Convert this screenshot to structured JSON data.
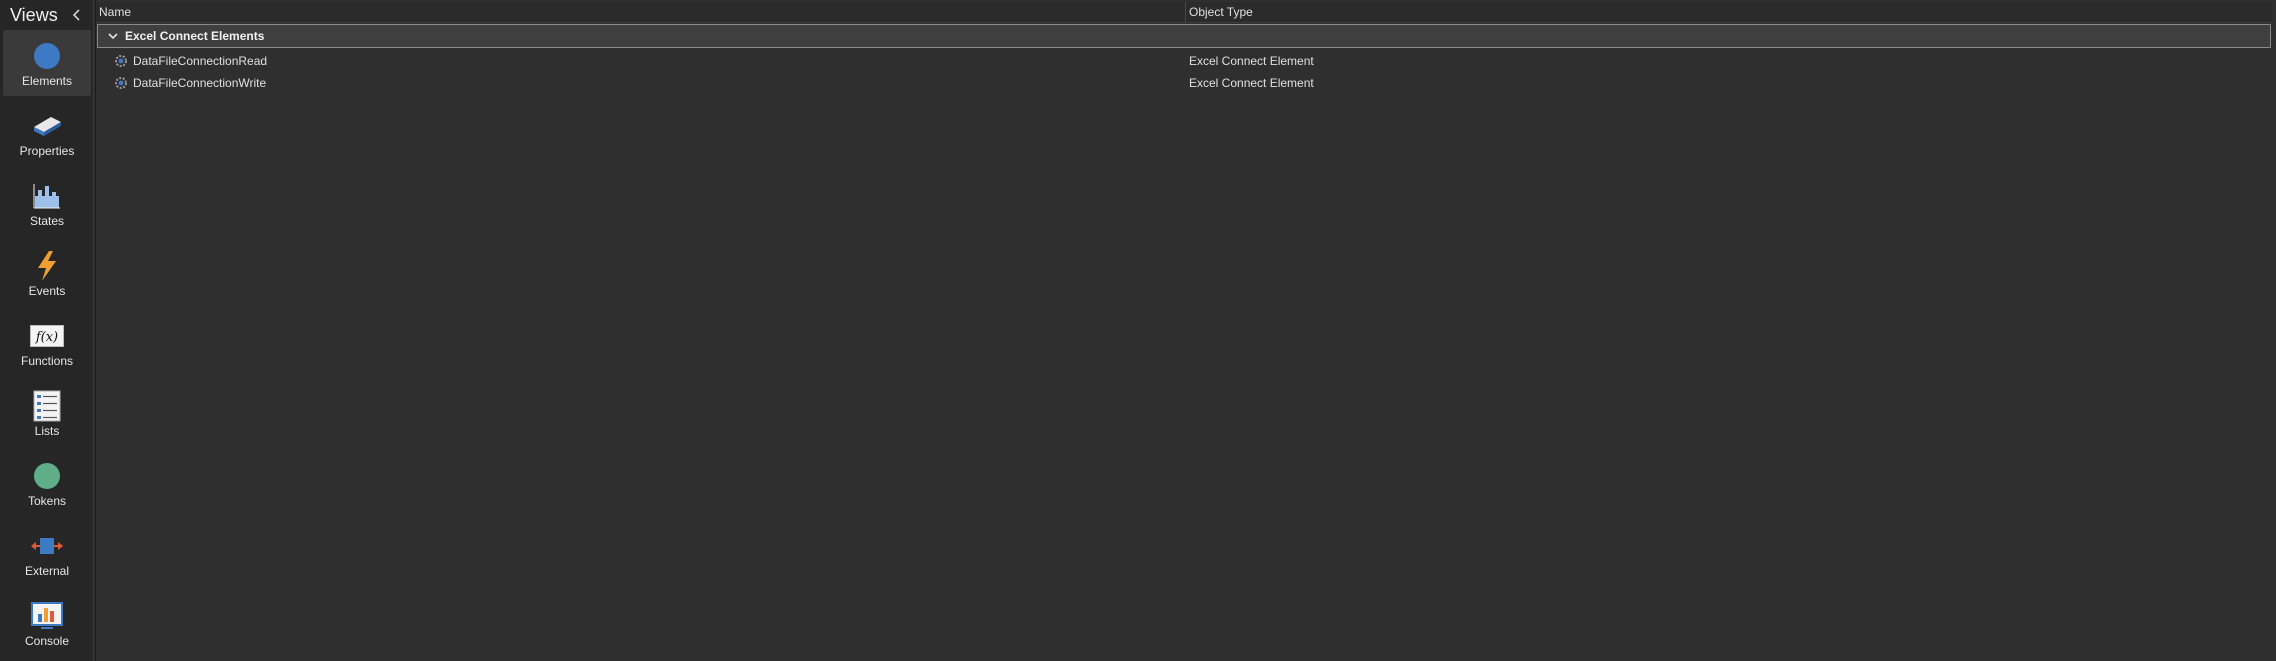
{
  "sidebar": {
    "title": "Views",
    "collapse_icon": "chevron-left-icon",
    "items": [
      {
        "label": "Elements",
        "icon": "elements-icon",
        "active": true
      },
      {
        "label": "Properties",
        "icon": "properties-icon",
        "active": false
      },
      {
        "label": "States",
        "icon": "states-icon",
        "active": false
      },
      {
        "label": "Events",
        "icon": "events-icon",
        "active": false
      },
      {
        "label": "Functions",
        "icon": "functions-icon",
        "active": false
      },
      {
        "label": "Lists",
        "icon": "lists-icon",
        "active": false
      },
      {
        "label": "Tokens",
        "icon": "tokens-icon",
        "active": false
      },
      {
        "label": "External",
        "icon": "external-icon",
        "active": false
      },
      {
        "label": "Console",
        "icon": "console-icon",
        "active": false
      }
    ]
  },
  "grid": {
    "columns": [
      "Name",
      "Object Type"
    ],
    "group": {
      "label": "Excel Connect Elements",
      "expanded": true
    },
    "rows": [
      {
        "name": "DataFileConnectionRead",
        "type": "Excel Connect Element",
        "icon": "gear-element-icon"
      },
      {
        "name": "DataFileConnectionWrite",
        "type": "Excel Connect Element",
        "icon": "gear-element-icon"
      }
    ]
  },
  "colors": {
    "elements_blue": "#3e7ac4",
    "tokens_green": "#5fae88",
    "events_orange": "#f0a030",
    "external_red": "#e05a3a"
  }
}
